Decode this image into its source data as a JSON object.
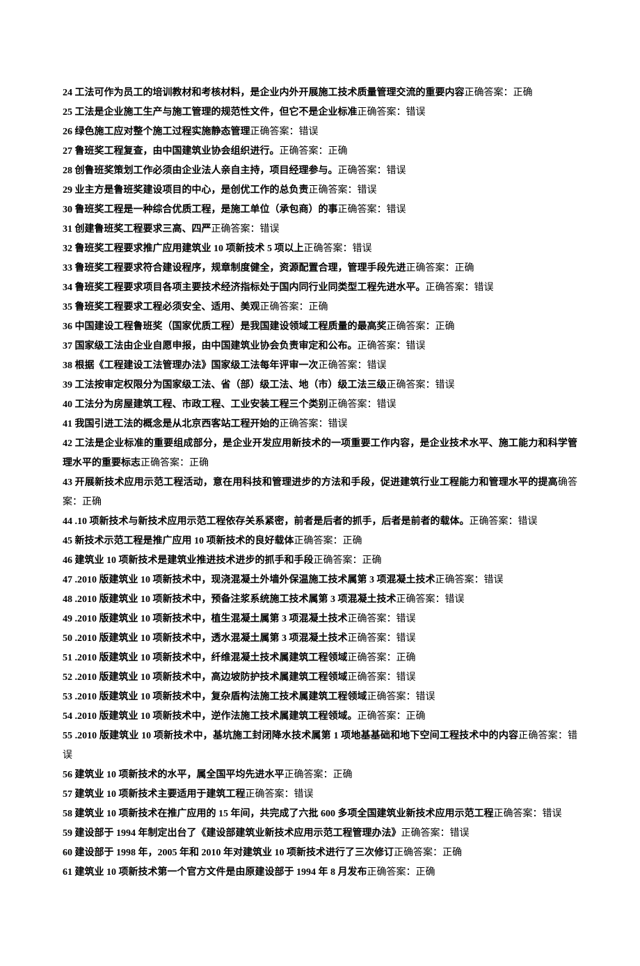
{
  "answer_label": "正确答案：",
  "answer_label_alt": "确答案：",
  "items": [
    {
      "num": "24",
      "q": "工法可作为员工的培训教材和考核材料，是企业内外开展施工技术质量管理交流的重要内容",
      "ans": "正确"
    },
    {
      "num": "25",
      "q": "工法是企业施工生产与施工管理的规范性文件，但它不是企业标准",
      "ans": "错误"
    },
    {
      "num": "26",
      "q": "绿色施工应对整个施工过程实施静态管理",
      "ans": "错误"
    },
    {
      "num": "27",
      "q": "鲁班奖工程复查，由中国建筑业协会组织进行。",
      "ans": "正确"
    },
    {
      "num": "28",
      "q": "创鲁班奖策划工作必须由企业法人亲自主持，项目经理参与。",
      "ans": "错误"
    },
    {
      "num": "29",
      "q": "业主方是鲁班奖建设项目的中心，是创优工作的总负责",
      "ans": "错误"
    },
    {
      "num": "30",
      "q": "鲁班奖工程是一种综合优质工程，是施工单位（承包商）的事",
      "ans": "错误"
    },
    {
      "num": "31",
      "q": "创建鲁班奖工程要求三高、四严",
      "ans": "错误"
    },
    {
      "num": "32",
      "q": "鲁班奖工程要求推广应用建筑业 10 项新技术 5 项以上",
      "ans": "错误"
    },
    {
      "num": "33",
      "q": "鲁班奖工程要求符合建设程序，规章制度健全，资源配置合理，管理手段先进",
      "ans": "正确"
    },
    {
      "num": "34",
      "q": "鲁班奖工程要求项目各项主要技术经济指标处于国内同行业同类型工程先进水平。",
      "ans": "错误"
    },
    {
      "num": "35",
      "q": "鲁班奖工程要求工程必须安全、适用、美观",
      "ans": "正确"
    },
    {
      "num": "36",
      "q": "中国建设工程鲁班奖（国家优质工程）是我国建设领域工程质量的最高奖",
      "ans": "正确"
    },
    {
      "num": "37",
      "q": "国家级工法由企业自愿申报，由中国建筑业协会负责审定和公布。",
      "ans": "错误"
    },
    {
      "num": "38",
      "q": "根据《工程建设工法管理办法》国家级工法每年评审一次",
      "ans": "错误"
    },
    {
      "num": "39",
      "q": "工法按审定权限分为国家级工法、省（部）级工法、地（市）级工法三级",
      "ans": "错误"
    },
    {
      "num": "40",
      "q": "工法分为房屋建筑工程、市政工程、工业安装工程三个类别",
      "ans": "错误"
    },
    {
      "num": "41",
      "q": "我国引进工法的概念是从北京西客站工程开始的",
      "ans": "错误"
    },
    {
      "num": "42",
      "q": "工法是企业标准的重要组成部分，是企业开发应用新技术的一项重要工作内容，是企业技术水平、施工能力和科学管理水平的重要标志",
      "ans": "正确"
    },
    {
      "num": "43",
      "q": "开展新技术应用示范工程活动，意在用科技和管理进步的方法和手段，促进建筑行业工程能力和管理水平的提高",
      "ans": "正确",
      "alt_label": true
    },
    {
      "num": "44",
      "q": ".10 项新技术与新技术应用示范工程依存关系紧密，前者是后者的抓手，后者是前者的载体。",
      "ans": "错误"
    },
    {
      "num": "45",
      "q": "新技术示范工程是推广应用 10 项新技术的良好载体",
      "ans": "正确"
    },
    {
      "num": "46",
      "q": "建筑业 10 项新技术是建筑业推进技术进步的抓手和手段",
      "ans": "正确"
    },
    {
      "num": "47",
      "q": ".2010 版建筑业 10 项新技术中，现浇混凝土外墙外保温施工技术属第 3 项混凝土技术",
      "ans": "错误"
    },
    {
      "num": "48",
      "q": ".2010 版建筑业 10 项新技术中，预备注浆系统施工技术属第 3 项混凝土技术",
      "ans": "错误"
    },
    {
      "num": "49",
      "q": ".2010 版建筑业 10 项新技术中，植生混凝土属第 3 项混凝土技术",
      "ans": "错误"
    },
    {
      "num": "50",
      "q": ".2010 版建筑业 10 项新技术中，透水混凝土属第 3 项混凝土技术",
      "ans": "错误"
    },
    {
      "num": "51",
      "q": ".2010 版建筑业 10 项新技术中，纤维混凝土技术属建筑工程领域",
      "ans": "正确"
    },
    {
      "num": "52",
      "q": ".2010 版建筑业 10 项新技术中，高边坡防护技术属建筑工程领域",
      "ans": "错误"
    },
    {
      "num": "53",
      "q": ".2010 版建筑业 10 项新技术中，复杂盾构法施工技术属建筑工程领域",
      "ans": "错误"
    },
    {
      "num": "54",
      "q": ".2010 版建筑业 10 项新技术中，逆作法施工技术属建筑工程领域。",
      "ans": "正确"
    },
    {
      "num": "55",
      "q": ".2010 版建筑业 10 项新技术中，基坑施工封闭降水技术属第 1 项地基基础和地下空间工程技术中的内容",
      "ans": "错误"
    },
    {
      "num": "56",
      "q": "建筑业 10 项新技术的水平，属全国平均先进水平",
      "ans": "正确"
    },
    {
      "num": "57",
      "q": "建筑业 10 项新技术主要适用于建筑工程",
      "ans": "错误"
    },
    {
      "num": "58",
      "q": "建筑业 10 项新技术在推广应用的 15 年间，共完成了六批 600 多项全国建筑业新技术应用示范工程",
      "ans": "错误"
    },
    {
      "num": "59",
      "q": "建设部于 1994 年制定出台了《建设部建筑业新技术应用示范工程管理办法》",
      "ans": "错误"
    },
    {
      "num": "60",
      "q": "建设部于 1998 年，2005 年和 2010 年对建筑业 10 项新技术进行了三次修订",
      "ans": "正确"
    },
    {
      "num": "61",
      "q": "建筑业 10 项新技术第一个官方文件是由原建设部于 1994 年 8 月发布",
      "ans": "正确"
    }
  ]
}
